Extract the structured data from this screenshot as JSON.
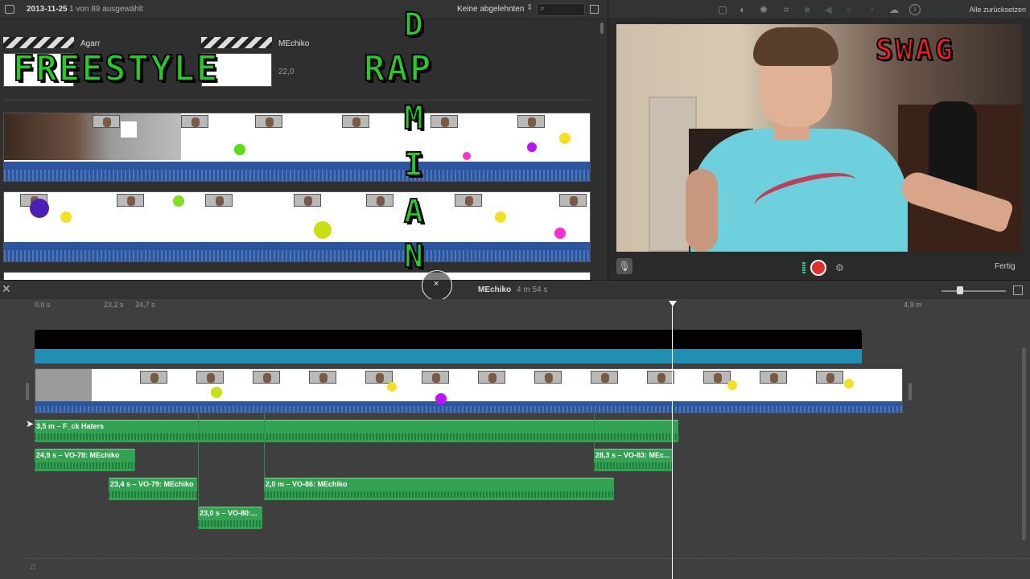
{
  "browser": {
    "date": "2013-11-25",
    "selection_text": "1 von 89 ausgewählt",
    "filter_label": "Keine abgelehnten",
    "clip1_title": "Agarr",
    "clip2_title": "MEchiko",
    "clip2_duration_partial": "22,0"
  },
  "viewer": {
    "reset_label": "Alle zurücksetzen",
    "done_label": "Fertig"
  },
  "overlays": {
    "freestyle": "FREESTYLE",
    "rap": "RAP",
    "vertical_letters": [
      "D",
      "M",
      "I",
      "A",
      "N"
    ],
    "swag": "SWAG"
  },
  "timeline": {
    "project_title": "MEchiko",
    "project_duration": "4 m 54 s",
    "ruler": [
      "0,0 s",
      "23,2 s",
      "24,7 s",
      "4,9 m"
    ],
    "clips": [
      {
        "label": "3,5 m – F_ck Haters"
      },
      {
        "label": "24,9 s – VO-78: MEchiko"
      },
      {
        "label": "28,3 s – VO-83: MEc..."
      },
      {
        "label": "23,4 s – VO-79: MEchiko"
      },
      {
        "label": "2,0 m – VO-86: MEchiko"
      },
      {
        "label": "23,0 s – VO-80:..."
      }
    ]
  },
  "icons": [
    "sidebar-icon",
    "search-icon",
    "grid-icon",
    "crop-icon",
    "info-icon",
    "microphone-icon",
    "record-icon",
    "settings-icon",
    "close-icon",
    "music-icon"
  ],
  "colors": {
    "accent_green": "#34a253",
    "record_red": "#e0302a",
    "overlay_green": "#22d022",
    "swag_red": "#ff1a1a"
  }
}
